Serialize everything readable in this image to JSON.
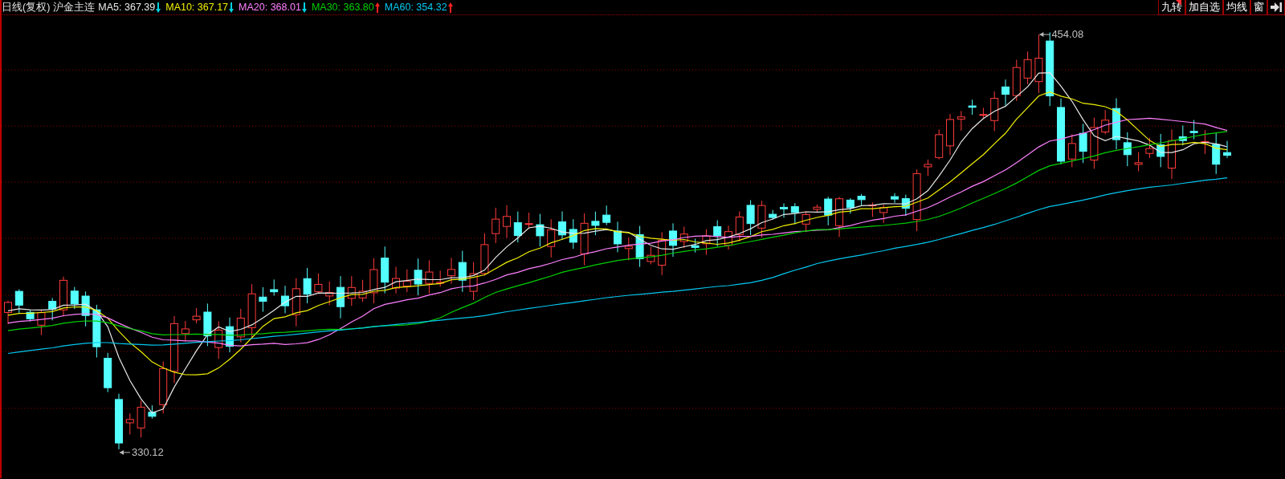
{
  "header": {
    "period": "日线(复权)",
    "symbol": "沪金主连",
    "ma": [
      {
        "label": "MA5:",
        "value": "367.39",
        "rising": false,
        "arrow": {
          "color": "#00d0e0"
        },
        "color": "#e8e8e8"
      },
      {
        "label": "MA10:",
        "value": "367.17",
        "rising": false,
        "arrow": {
          "color": "#00d0e0"
        },
        "color": "#f0f000"
      },
      {
        "label": "MA20:",
        "value": "368.01",
        "rising": false,
        "arrow": {
          "color": "#00d0e0"
        },
        "color": "#ff80ff"
      },
      {
        "label": "MA30:",
        "value": "363.80",
        "rising": true,
        "arrow": {
          "color": "#ff2020"
        },
        "color": "#00d000"
      },
      {
        "label": "MA60:",
        "value": "354.32",
        "rising": true,
        "arrow": {
          "color": "#ff2020"
        },
        "color": "#00c8f0"
      }
    ]
  },
  "buttons": [
    {
      "kind": "text",
      "label": "九转",
      "marked": true
    },
    {
      "kind": "text",
      "label": "加自选",
      "marked": false
    },
    {
      "kind": "text",
      "label": "均线",
      "marked": false
    },
    {
      "kind": "text",
      "label": "窗",
      "marked": false
    },
    {
      "kind": "icon"
    }
  ],
  "chart": {
    "high_label": "454.08",
    "low_label": "330.12"
  }
}
